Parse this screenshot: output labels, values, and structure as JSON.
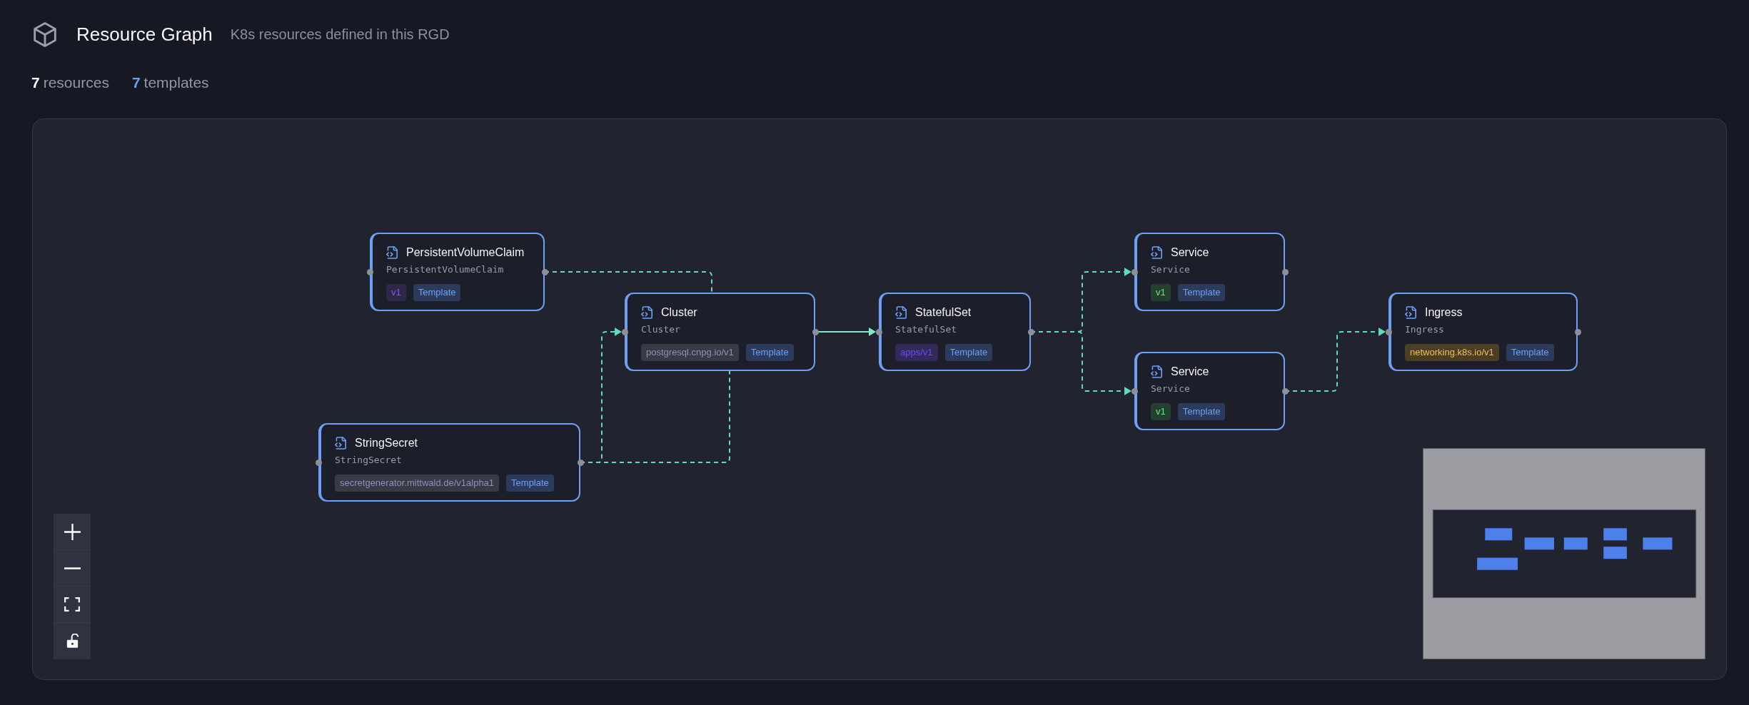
{
  "header": {
    "title": "Resource Graph",
    "subtitle": "K8s resources defined in this RGD"
  },
  "stats": [
    {
      "kind": "total",
      "count": "7",
      "label": "resources"
    },
    {
      "kind": "templates",
      "count": "7",
      "label": "templates"
    }
  ],
  "graph": {
    "nodes": [
      {
        "title": "PersistentVolumeClaim",
        "resource_kind": "PersistentVolumeClaim",
        "version": {
          "text": "v1",
          "color": "#2e2747"
        },
        "badge": "Template"
      },
      {
        "title": "StringSecret",
        "resource_kind": "StringSecret",
        "version": {
          "text": "secretgenerator.mittwald.de/v1alpha1",
          "color": "#383a45"
        },
        "badge": "Template"
      },
      {
        "title": "Cluster",
        "resource_kind": "Cluster",
        "version": {
          "text": "postgresql.cnpg.io/v1",
          "color": "#383a45"
        },
        "badge": "Template"
      },
      {
        "title": "StatefulSet",
        "resource_kind": "StatefulSet",
        "version": {
          "text": "apps/v1",
          "color": "#33295b"
        },
        "badge": "Template"
      },
      {
        "title": "Service",
        "resource_kind": "Service",
        "version": {
          "text": "v1",
          "color": "#233f2d"
        },
        "badge": "Template"
      },
      {
        "title": "Service",
        "resource_kind": "Service",
        "version": {
          "text": "v1",
          "color": "#233f2d"
        },
        "badge": "Template"
      },
      {
        "title": "Ingress",
        "resource_kind": "Ingress",
        "version": {
          "text": "networking.k8s.io/v1",
          "color": "#4a3e25"
        },
        "badge": "Template"
      }
    ],
    "edges": [
      {
        "kind": "dashed"
      },
      {
        "kind": "dashed"
      },
      {
        "kind": "dashed"
      },
      {
        "kind": "solid"
      },
      {
        "kind": "dashed"
      },
      {
        "kind": "dashed"
      },
      {
        "kind": "dashed"
      }
    ]
  },
  "canvas_controls": {
    "locked": false
  }
}
